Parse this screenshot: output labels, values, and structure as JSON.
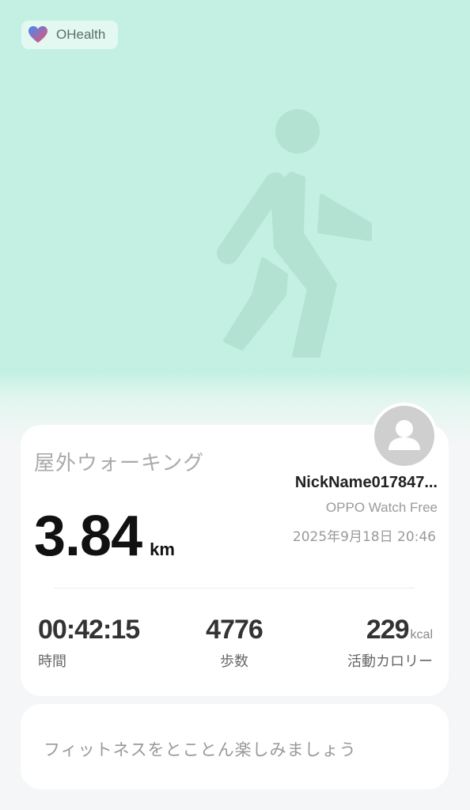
{
  "brand": {
    "name": "OHealth",
    "icon": "heart-icon"
  },
  "hero": {
    "icon": "walking-person-icon"
  },
  "summary": {
    "activity_type": "屋外ウォーキング",
    "distance": "3.84",
    "distance_unit": "km",
    "user": {
      "nickname": "NickName017847...",
      "device": "OPPO Watch Free",
      "datetime": "2025年9月18日 20:46",
      "avatar_icon": "user-avatar-icon"
    },
    "stats": {
      "duration": {
        "value": "00:42:15",
        "label": "時間"
      },
      "steps": {
        "value": "4776",
        "label": "歩数"
      },
      "calories": {
        "value": "229",
        "unit": "kcal",
        "label": "活動カロリー"
      }
    }
  },
  "banner": {
    "text": "フィットネスをとことん楽しみましょう"
  },
  "colors": {
    "background_top": "#c3f0e2",
    "background_bottom": "#f4f6f7",
    "card": "#ffffff",
    "hero_figure": "#b3e1d2"
  }
}
